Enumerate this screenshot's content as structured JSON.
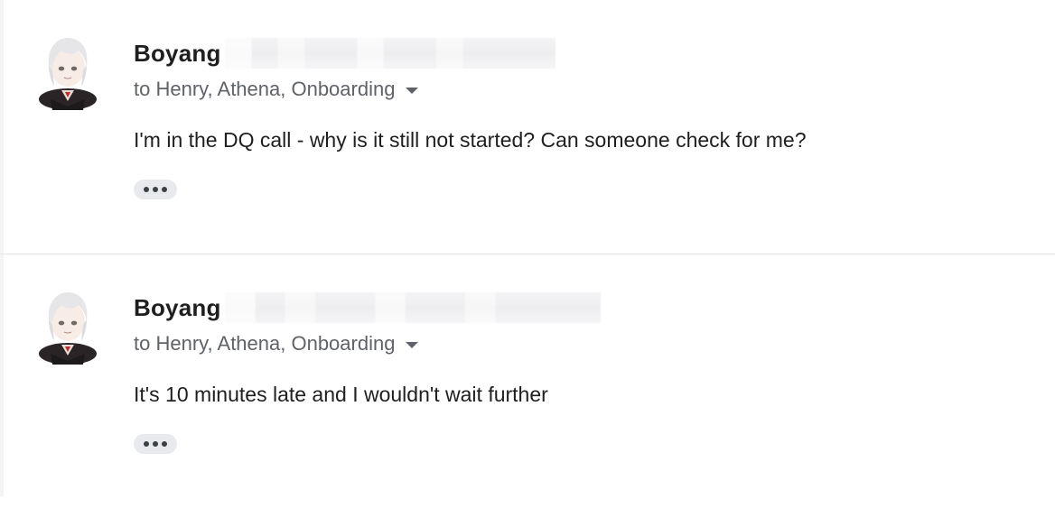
{
  "messages": [
    {
      "sender": "Boyang",
      "recipients": "to Henry, Athena, Onboarding",
      "body": "I'm in the DQ call - why is it still not started? Can someone check for me?",
      "more_icon": "ellipsis-icon"
    },
    {
      "sender": "Boyang",
      "recipients": "to Henry, Athena, Onboarding",
      "body": "It's 10 minutes late and I wouldn't wait further",
      "more_icon": "ellipsis-icon"
    }
  ]
}
